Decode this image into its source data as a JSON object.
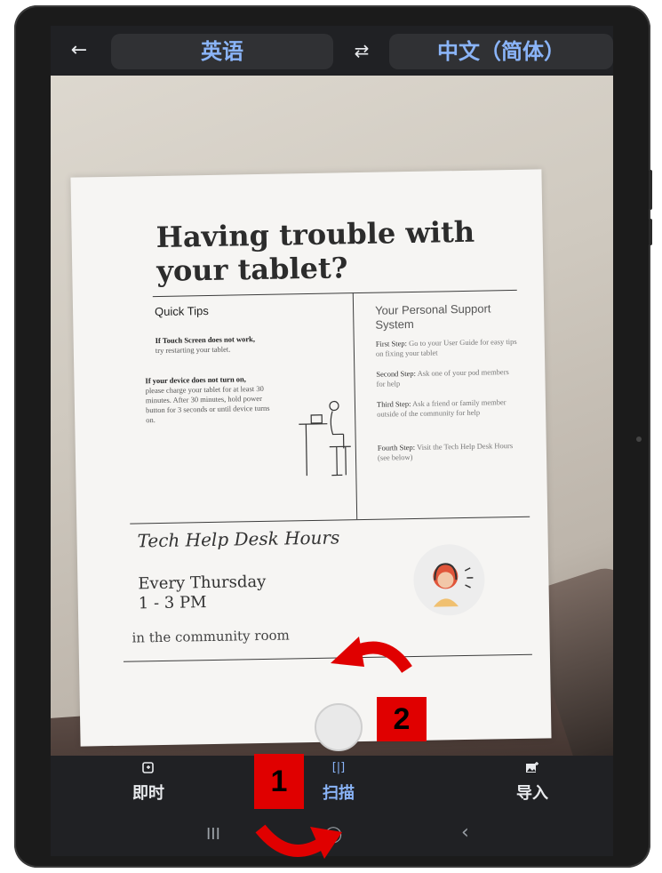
{
  "header": {
    "back_icon": "←",
    "source_language": "英语",
    "swap_icon": "⇄",
    "target_language": "中文（简体）"
  },
  "document": {
    "title": "Having trouble with your tablet?",
    "quick_tips_title": "Quick Tips",
    "tip1_bold": "If Touch Screen does not work,",
    "tip1_rest": "try restarting your tablet.",
    "tip2_bold": "If your device does not turn on,",
    "tip2_rest": "please charge your tablet for at least 30 minutes. After 30 minutes, hold power button for 3 seconds or until device turns on.",
    "support_title": "Your Personal Support System",
    "step1_bold": "First Step:",
    "step1_rest": "Go to your User Guide for easy tips on fixing your tablet",
    "step2_bold": "Second Step:",
    "step2_rest": "Ask one of your pod members for help",
    "step3_bold": "Third Step:",
    "step3_rest": "Ask a friend or family member outside of the community for help",
    "step4_bold": "Fourth Step:",
    "step4_rest": "Visit the Tech Help Desk Hours (see below)",
    "help_desk_title": "Tech Help Desk Hours",
    "help_desk_day": "Every Thursday",
    "help_desk_time": "1 - 3 PM",
    "help_desk_location": "in the community room"
  },
  "modes": {
    "instant_label": "即时",
    "scan_label": "扫描",
    "import_label": "导入",
    "instant_icon": "instant-translate-icon",
    "scan_icon": "scan-icon",
    "import_icon": "import-image-icon"
  },
  "navbar": {
    "recents_icon": "III",
    "home_icon": "◯",
    "back_icon": "‹"
  },
  "annotations": {
    "tag1": "1",
    "tag2": "2",
    "tag_color": "#e00000"
  },
  "colors": {
    "accent": "#8ab4f8",
    "bar_bg": "#202124"
  }
}
